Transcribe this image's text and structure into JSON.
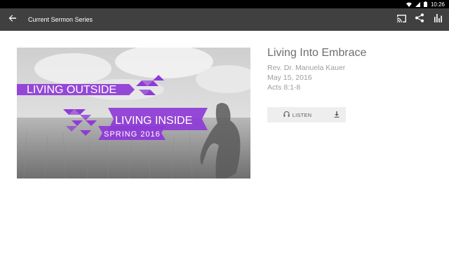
{
  "status_bar": {
    "time": "10:26"
  },
  "toolbar": {
    "title": "Current Sermon Series",
    "icons": [
      "back-arrow-icon",
      "cast-icon",
      "share-icon",
      "equalizer-icon"
    ]
  },
  "artwork": {
    "line1": "LIVING OUTSIDE",
    "line2": "LIVING INSIDE",
    "line3": "SPRING 2016",
    "accent_color": "#8e3bd6"
  },
  "sermon": {
    "title": "Living Into Embrace",
    "speaker": "Rev. Dr. Manuela Kauer",
    "date": "May 15, 2016",
    "scripture": "Acts 8:1-8"
  },
  "actions": {
    "listen_label": "LISTEN",
    "icons": [
      "headphones-icon",
      "download-icon"
    ]
  },
  "colors": {
    "toolbar": "#404040",
    "status_bar": "#000000",
    "title_text": "#6e6e6e",
    "meta_text": "#9e9e9e",
    "button_bg": "#eeeeee"
  }
}
